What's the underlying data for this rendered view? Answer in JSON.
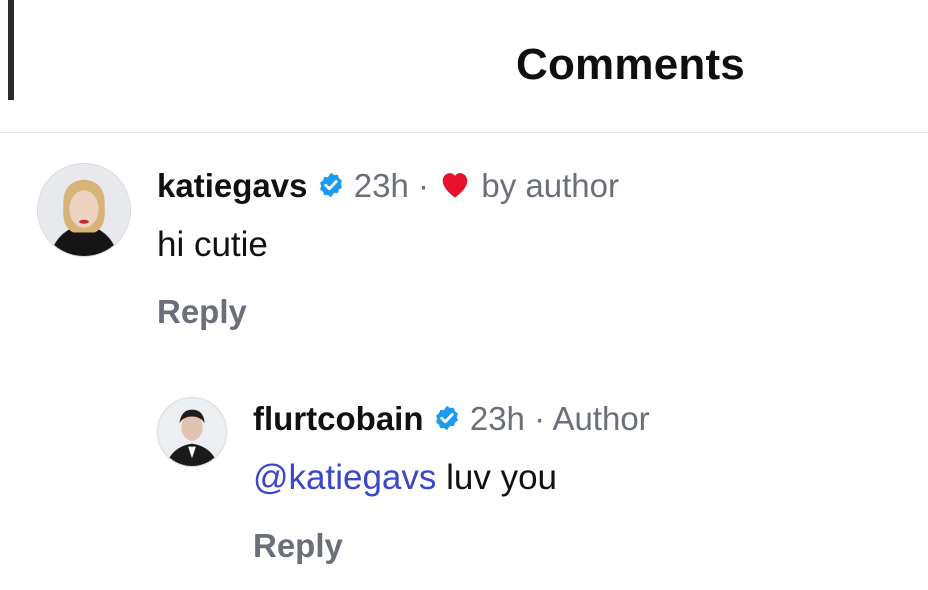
{
  "header": {
    "title": "Comments"
  },
  "comments": [
    {
      "username": "katiegavs",
      "time": "23h",
      "separator": "·",
      "liked_by": "by author",
      "text": "hi cutie",
      "reply_label": "Reply"
    },
    {
      "username": "flurtcobain",
      "time": "23h",
      "separator": "·",
      "role": "Author",
      "mention": "@katiegavs",
      "text": " luv you",
      "reply_label": "Reply"
    }
  ],
  "colors": {
    "verified": "#1d9bf0",
    "heart": "#e8112d",
    "mention": "#3b46c9",
    "meta": "#6b6f78"
  }
}
